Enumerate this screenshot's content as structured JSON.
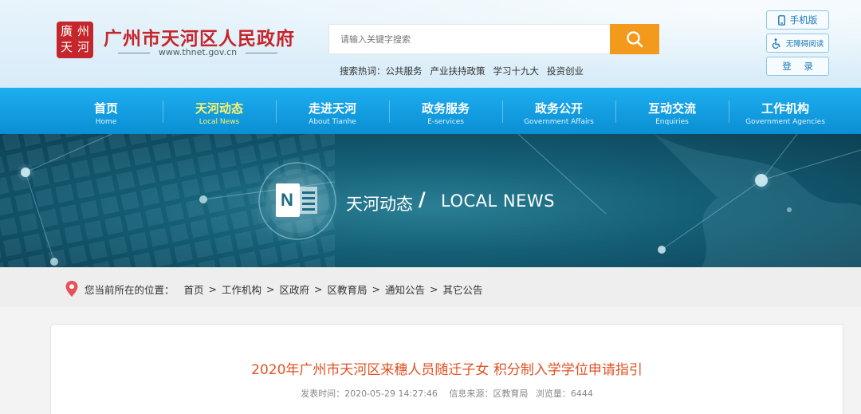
{
  "header": {
    "logo_chars": [
      "廣",
      "州",
      "天",
      "河"
    ],
    "site_title": "广州市天河区人民政府",
    "site_url": "www.thnet.gov.cn",
    "search_placeholder": "请输入关键字搜索",
    "hot_label": "搜索热词：",
    "hot_words": [
      "公共服务",
      "产业扶持政策",
      "学习十九大",
      "投资创业"
    ],
    "mobile_label": "手机版",
    "accessibility_label": "无障碍阅读",
    "login_label": "登 录"
  },
  "nav": {
    "items": [
      {
        "zh": "首页",
        "en": "Home"
      },
      {
        "zh": "天河动态",
        "en": "Local News"
      },
      {
        "zh": "走进天河",
        "en": "About Tianhe"
      },
      {
        "zh": "政务服务",
        "en": "E-services"
      },
      {
        "zh": "政务公开",
        "en": "Government Affairs"
      },
      {
        "zh": "互动交流",
        "en": "Enquiries"
      },
      {
        "zh": "工作机构",
        "en": "Government Agencies"
      }
    ],
    "active_index": 1
  },
  "banner": {
    "icon_letter": "N",
    "title_zh": "天河动态",
    "slash": "/",
    "title_en": "LOCAL NEWS"
  },
  "breadcrumb": {
    "lead": "您当前所在的位置：",
    "items": [
      "首页",
      "工作机构",
      "区政府",
      "区教育局",
      "通知公告",
      "其它公告"
    ],
    "separator": ">"
  },
  "article": {
    "title": "2020年广州市天河区来穗人员随迁子女 积分制入学学位申请指引",
    "publish_label": "发表时间：",
    "publish_time": "2020-05-29 14:27:46",
    "source_label": "信息来源：",
    "source": "区教育局",
    "views_label": "浏览量：",
    "views": "6444"
  },
  "colors": {
    "brand_red": "#c5262b",
    "nav_blue": "#1eaef0",
    "search_orange": "#f39a1c",
    "title_orange": "#e05324",
    "active_yellow": "#fff36a"
  }
}
